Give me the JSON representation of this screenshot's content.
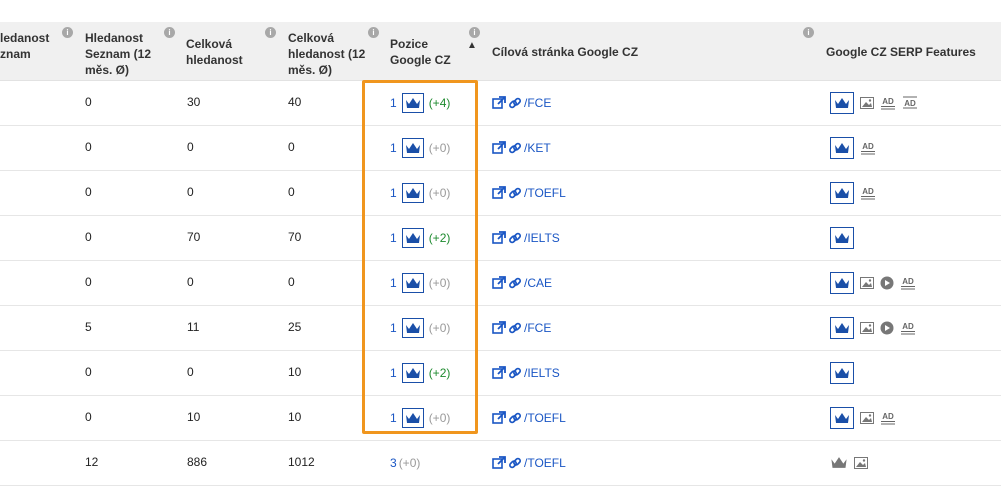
{
  "header": {
    "col_search_partial": "ledanost\nznam",
    "col_seznam": "Hledanost Seznam (12 měs. Ø)",
    "col_total": "Celková hledanost",
    "col_total12": "Celková hledanost (12 měs. Ø)",
    "col_position": "Pozice Google CZ",
    "col_target": "Cílová stránka Google CZ",
    "col_features": "Google CZ SERP Features",
    "info_glyph": "i",
    "sort_glyph": "▲"
  },
  "rows": [
    {
      "seznam": "0",
      "total": "30",
      "total12": "40",
      "position": "1",
      "crown": true,
      "change": "(+4)",
      "change_type": "pos",
      "target": "/FCE",
      "features": [
        "crown",
        "image",
        "ad",
        "ad-lines"
      ]
    },
    {
      "seznam": "0",
      "total": "0",
      "total12": "0",
      "position": "1",
      "crown": true,
      "change": "(+0)",
      "change_type": "zero",
      "target": "/KET",
      "features": [
        "crown",
        "ad"
      ]
    },
    {
      "seznam": "0",
      "total": "0",
      "total12": "0",
      "position": "1",
      "crown": true,
      "change": "(+0)",
      "change_type": "zero",
      "target": "/TOEFL",
      "features": [
        "crown",
        "ad"
      ]
    },
    {
      "seznam": "0",
      "total": "70",
      "total12": "70",
      "position": "1",
      "crown": true,
      "change": "(+2)",
      "change_type": "pos",
      "target": "/IELTS",
      "features": [
        "crown"
      ]
    },
    {
      "seznam": "0",
      "total": "0",
      "total12": "0",
      "position": "1",
      "crown": true,
      "change": "(+0)",
      "change_type": "zero",
      "target": "/CAE",
      "features": [
        "crown",
        "image",
        "video",
        "ad"
      ]
    },
    {
      "seznam": "5",
      "total": "11",
      "total12": "25",
      "position": "1",
      "crown": true,
      "change": "(+0)",
      "change_type": "zero",
      "target": "/FCE",
      "features": [
        "crown",
        "image",
        "video",
        "ad"
      ]
    },
    {
      "seznam": "0",
      "total": "0",
      "total12": "10",
      "position": "1",
      "crown": true,
      "change": "(+2)",
      "change_type": "pos",
      "target": "/IELTS",
      "features": [
        "crown"
      ]
    },
    {
      "seznam": "0",
      "total": "10",
      "total12": "10",
      "position": "1",
      "crown": true,
      "change": "(+0)",
      "change_type": "zero",
      "target": "/TOEFL",
      "features": [
        "crown",
        "image",
        "ad"
      ]
    },
    {
      "seznam": "12",
      "total": "886",
      "total12": "1012",
      "position": "3",
      "crown": false,
      "change": "(+0)",
      "change_type": "zero",
      "target": "/TOEFL",
      "features": [
        "crown-gray",
        "image"
      ]
    }
  ],
  "colors": {
    "link": "#1a56c4",
    "positive": "#1d8a2e",
    "neutral": "#9a9a9a",
    "highlight": "#f0961e",
    "header_bg": "#f0f0f0"
  }
}
